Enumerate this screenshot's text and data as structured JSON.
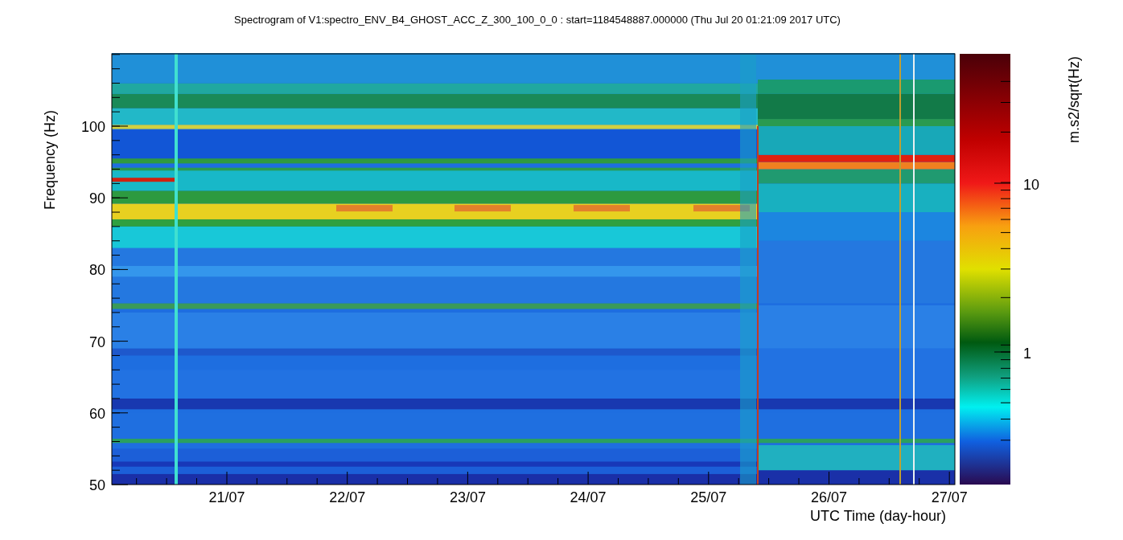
{
  "title": "Spectrogram of V1:spectro_ENV_B4_GHOST_ACC_Z_300_100_0_0 : start=1184548887.000000 (Thu Jul 20 01:21:09 2017 UTC)",
  "y_axis": {
    "label": "Frequency (Hz)",
    "ticks": [
      "100",
      "90",
      "80",
      "70",
      "60",
      "50"
    ]
  },
  "x_axis": {
    "label": "UTC Time (day-hour)",
    "ticks": [
      "21/07",
      "22/07",
      "23/07",
      "24/07",
      "25/07",
      "26/07",
      "27/07"
    ]
  },
  "colorbar": {
    "label": "m.s2/sqrt(Hz)",
    "ticks": [
      "10",
      "1"
    ]
  }
}
